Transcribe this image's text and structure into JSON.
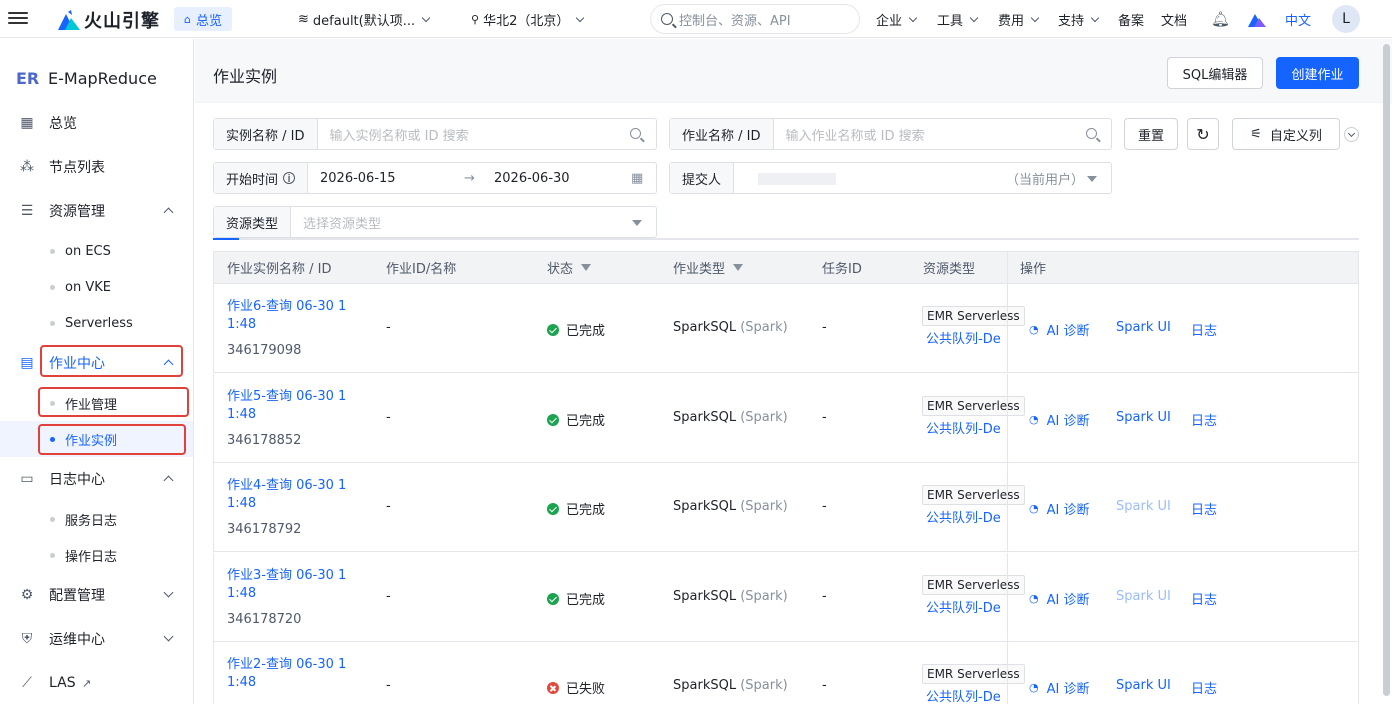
{
  "topbar": {
    "brand": "火山引擎",
    "overview": "总览",
    "project": "default(默认项...",
    "region": "华北2（北京）",
    "search_placeholder": "控制台、资源、API",
    "menu": [
      "企业",
      "工具",
      "费用",
      "支持"
    ],
    "links": [
      "备案",
      "文档"
    ],
    "lang": "中文",
    "avatar": "L"
  },
  "sidebar": {
    "product": "E-MapReduce",
    "items": {
      "overview": "总览",
      "nodes": "节点列表",
      "resources": "资源管理",
      "on_ecs": "on ECS",
      "on_vke": "on VKE",
      "serverless": "Serverless",
      "job_center": "作业中心",
      "job_manage": "作业管理",
      "job_instance": "作业实例",
      "log_center": "日志中心",
      "service_log": "服务日志",
      "op_log": "操作日志",
      "config": "配置管理",
      "ops": "运维中心",
      "las": "LAS"
    }
  },
  "page": {
    "title": "作业实例",
    "sql_editor": "SQL编辑器",
    "create_job": "创建作业"
  },
  "filters": {
    "instance_label": "实例名称 / ID",
    "instance_ph": "输入实例名称或 ID 搜索",
    "job_label": "作业名称 / ID",
    "job_ph": "输入作业名称或 ID 搜索",
    "reset": "重置",
    "custom_cols": "自定义列",
    "start_label": "开始时间",
    "start_date": "2026-06-15",
    "end_date": "2026-06-30",
    "submitter_label": "提交人",
    "submitter_hint": "（当前用户）",
    "res_type_label": "资源类型",
    "res_type_ph": "选择资源类型"
  },
  "table": {
    "headers": [
      "作业实例名称 / ID",
      "作业ID/名称",
      "状态",
      "作业类型",
      "任务ID",
      "资源类型",
      "操作"
    ],
    "rows": [
      {
        "name1": "作业6-查询 06-30 1",
        "name2": "1:48",
        "id": "346179098",
        "job": "-",
        "status": "已完成",
        "ok": true,
        "type": "SparkSQL",
        "type_sub": "(Spark)",
        "task": "-",
        "res_tag": "EMR Serverless",
        "res_link": "公共队列-De",
        "ai": "AI 诊断",
        "spark": "Spark UI",
        "spark_disabled": false,
        "log": "日志"
      },
      {
        "name1": "作业5-查询 06-30 1",
        "name2": "1:48",
        "id": "346178852",
        "job": "-",
        "status": "已完成",
        "ok": true,
        "type": "SparkSQL",
        "type_sub": "(Spark)",
        "task": "-",
        "res_tag": "EMR Serverless",
        "res_link": "公共队列-De",
        "ai": "AI 诊断",
        "spark": "Spark UI",
        "spark_disabled": false,
        "log": "日志"
      },
      {
        "name1": "作业4-查询 06-30 1",
        "name2": "1:48",
        "id": "346178792",
        "job": "-",
        "status": "已完成",
        "ok": true,
        "type": "SparkSQL",
        "type_sub": "(Spark)",
        "task": "-",
        "res_tag": "EMR Serverless",
        "res_link": "公共队列-De",
        "ai": "AI 诊断",
        "spark": "Spark UI",
        "spark_disabled": true,
        "log": "日志"
      },
      {
        "name1": "作业3-查询 06-30 1",
        "name2": "1:48",
        "id": "346178720",
        "job": "-",
        "status": "已完成",
        "ok": true,
        "type": "SparkSQL",
        "type_sub": "(Spark)",
        "task": "-",
        "res_tag": "EMR Serverless",
        "res_link": "公共队列-De",
        "ai": "AI 诊断",
        "spark": "Spark UI",
        "spark_disabled": true,
        "log": "日志"
      },
      {
        "name1": "作业2-查询 06-30 1",
        "name2": "1:48",
        "id": "",
        "job": "-",
        "status": "已失败",
        "ok": false,
        "type": "SparkSQL",
        "type_sub": "(Spark)",
        "task": "-",
        "res_tag": "EMR Serverless",
        "res_link": "公共队列-De",
        "ai": "AI 诊断",
        "spark": "Spark UI",
        "spark_disabled": false,
        "log": "日志"
      }
    ]
  },
  "colors": {
    "primary": "#1664ff",
    "success": "#1ba34f",
    "error": "#e04a3a",
    "highlight_box": "#e0413a"
  }
}
